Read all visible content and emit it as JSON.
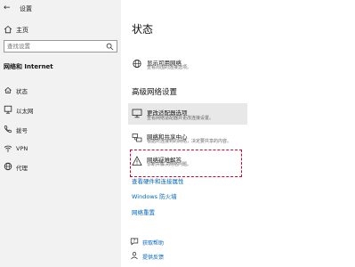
{
  "window": {
    "title": "设置",
    "back_glyph": "←"
  },
  "sidebar": {
    "home_label": "主页",
    "search_placeholder": "查找设置",
    "section_title": "网络和 Internet",
    "items": [
      {
        "label": "状态",
        "icon": "home-network-icon"
      },
      {
        "label": "以太网",
        "icon": "ethernet-icon"
      },
      {
        "label": "拨号",
        "icon": "dialup-icon"
      },
      {
        "label": "VPN",
        "icon": "vpn-icon"
      },
      {
        "label": "代理",
        "icon": "globe-icon"
      }
    ]
  },
  "main": {
    "title": "状态",
    "show_networks": {
      "title": "显示可用网络",
      "subtitle": "查看周围的连接选项。"
    },
    "advanced_title": "高级网络设置",
    "adapter_options": {
      "title": "更改适配器选项",
      "subtitle": "查看网络适配器并更改连接设置。"
    },
    "sharing_center": {
      "title": "网络和共享中心",
      "subtitle": "根据所连接到的网络，决定要共享的内容。"
    },
    "troubleshooter": {
      "title": "网络疑难解答",
      "subtitle": "诊断并解决网络问题。"
    },
    "links": [
      "查看硬件和连接属性",
      "Windows 防火墙",
      "网络重置"
    ],
    "help": {
      "get_help": "获取帮助",
      "feedback": "提供反馈"
    }
  },
  "colors": {
    "accent": "#0067c0",
    "highlight": "#e0002a",
    "sidebar_bg": "#f2f2f2"
  }
}
